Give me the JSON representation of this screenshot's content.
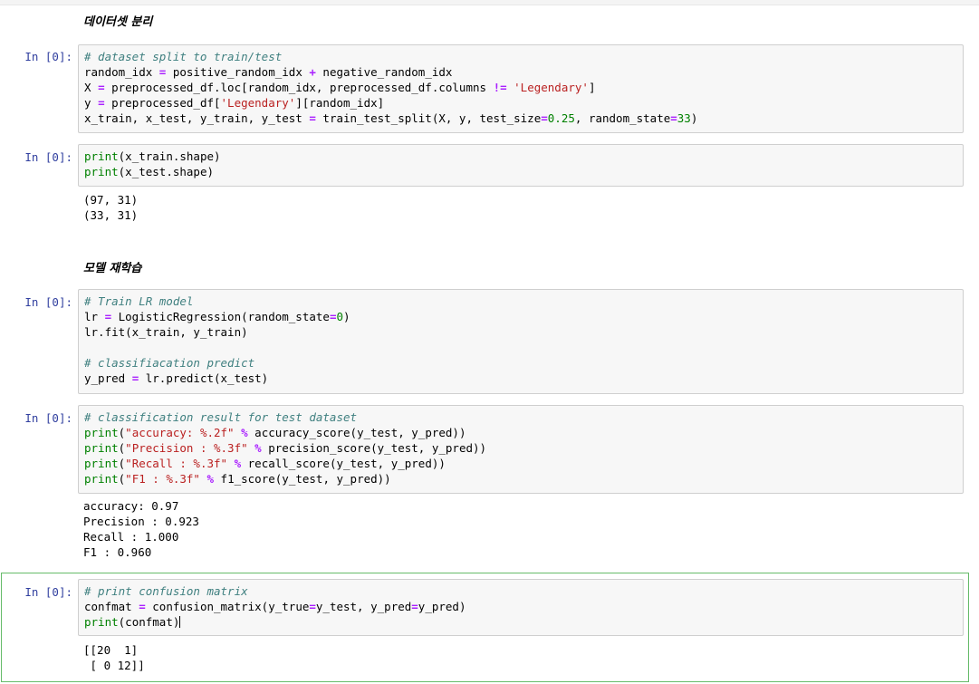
{
  "headings": {
    "split": "데이터셋 분리",
    "retrain": "모델 재학습"
  },
  "prompt_label": "In [0]:",
  "cells": {
    "c1": {
      "lines": [
        [
          {
            "t": "# dataset split to train/test",
            "c": "cm"
          }
        ],
        [
          {
            "t": "random_idx "
          },
          {
            "t": "=",
            "c": "op"
          },
          {
            "t": " positive_random_idx "
          },
          {
            "t": "+",
            "c": "op"
          },
          {
            "t": " negative_random_idx"
          }
        ],
        [
          {
            "t": "X "
          },
          {
            "t": "=",
            "c": "op"
          },
          {
            "t": " preprocessed_df.loc[random_idx, preprocessed_df.columns "
          },
          {
            "t": "!=",
            "c": "op"
          },
          {
            "t": " "
          },
          {
            "t": "'Legendary'",
            "c": "st"
          },
          {
            "t": "]"
          }
        ],
        [
          {
            "t": "y "
          },
          {
            "t": "=",
            "c": "op"
          },
          {
            "t": " preprocessed_df["
          },
          {
            "t": "'Legendary'",
            "c": "st"
          },
          {
            "t": "][random_idx]"
          }
        ],
        [
          {
            "t": "x_train, x_test, y_train, y_test "
          },
          {
            "t": "=",
            "c": "op"
          },
          {
            "t": " train_test_split(X, y, test_size"
          },
          {
            "t": "=",
            "c": "op"
          },
          {
            "t": "0.25",
            "c": "nm"
          },
          {
            "t": ", random_state"
          },
          {
            "t": "=",
            "c": "op"
          },
          {
            "t": "33",
            "c": "nm"
          },
          {
            "t": ")"
          }
        ]
      ]
    },
    "c2": {
      "lines": [
        [
          {
            "t": "print",
            "c": "bi"
          },
          {
            "t": "(x_train.shape)"
          }
        ],
        [
          {
            "t": "print",
            "c": "bi"
          },
          {
            "t": "(x_test.shape)"
          }
        ]
      ],
      "output": [
        "(97, 31)",
        "(33, 31)"
      ]
    },
    "c3": {
      "lines": [
        [
          {
            "t": "# Train LR model",
            "c": "cm"
          }
        ],
        [
          {
            "t": "lr "
          },
          {
            "t": "=",
            "c": "op"
          },
          {
            "t": " LogisticRegression(random_state"
          },
          {
            "t": "=",
            "c": "op"
          },
          {
            "t": "0",
            "c": "nm"
          },
          {
            "t": ")"
          }
        ],
        [
          {
            "t": "lr.fit(x_train, y_train)"
          }
        ],
        [
          {
            "t": ""
          }
        ],
        [
          {
            "t": "# classifiacation predict",
            "c": "cm"
          }
        ],
        [
          {
            "t": "y_pred "
          },
          {
            "t": "=",
            "c": "op"
          },
          {
            "t": " lr.predict(x_test)"
          }
        ]
      ]
    },
    "c4": {
      "lines": [
        [
          {
            "t": "# classification result for test dataset",
            "c": "cm"
          }
        ],
        [
          {
            "t": "print",
            "c": "bi"
          },
          {
            "t": "("
          },
          {
            "t": "\"accuracy: %.2f\"",
            "c": "st"
          },
          {
            "t": " "
          },
          {
            "t": "%",
            "c": "op"
          },
          {
            "t": " accuracy_score(y_test, y_pred))"
          }
        ],
        [
          {
            "t": "print",
            "c": "bi"
          },
          {
            "t": "("
          },
          {
            "t": "\"Precision : %.3f\"",
            "c": "st"
          },
          {
            "t": " "
          },
          {
            "t": "%",
            "c": "op"
          },
          {
            "t": " precision_score(y_test, y_pred))"
          }
        ],
        [
          {
            "t": "print",
            "c": "bi"
          },
          {
            "t": "("
          },
          {
            "t": "\"Recall : %.3f\"",
            "c": "st"
          },
          {
            "t": " "
          },
          {
            "t": "%",
            "c": "op"
          },
          {
            "t": " recall_score(y_test, y_pred))"
          }
        ],
        [
          {
            "t": "print",
            "c": "bi"
          },
          {
            "t": "("
          },
          {
            "t": "\"F1 : %.3f\"",
            "c": "st"
          },
          {
            "t": " "
          },
          {
            "t": "%",
            "c": "op"
          },
          {
            "t": " f1_score(y_test, y_pred))"
          }
        ]
      ],
      "output": [
        "accuracy: 0.97",
        "Precision : 0.923",
        "Recall : 1.000",
        "F1 : 0.960"
      ]
    },
    "c5": {
      "lines": [
        [
          {
            "t": "# print confusion matrix",
            "c": "cm"
          }
        ],
        [
          {
            "t": "confmat "
          },
          {
            "t": "=",
            "c": "op"
          },
          {
            "t": " confusion_matrix(y_true"
          },
          {
            "t": "=",
            "c": "op"
          },
          {
            "t": "y_test, y_pred"
          },
          {
            "t": "=",
            "c": "op"
          },
          {
            "t": "y_pred)"
          }
        ],
        [
          {
            "t": "print",
            "c": "bi"
          },
          {
            "t": "(confmat)"
          }
        ]
      ],
      "output": [
        "[[20  1]",
        " [ 0 12]]"
      ]
    }
  }
}
